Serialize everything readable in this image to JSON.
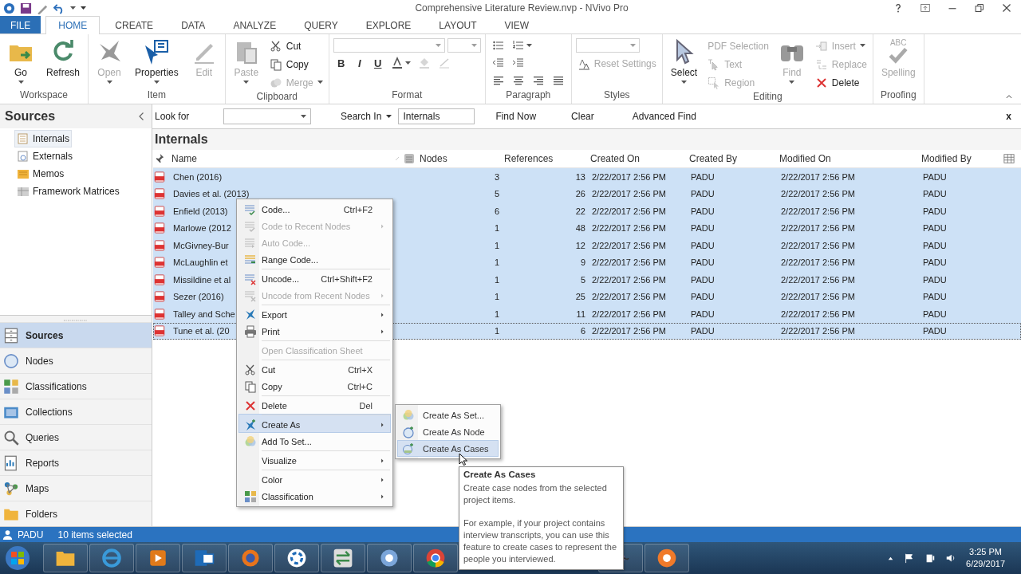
{
  "window": {
    "title": "Comprehensive Literature Review.nvp - NVivo Pro"
  },
  "ribbon_tabs": [
    {
      "label": "FILE",
      "kind": "backstage",
      "selected": false
    },
    {
      "label": "HOME",
      "kind": "tab",
      "selected": true
    },
    {
      "label": "CREATE",
      "kind": "tab",
      "selected": false
    },
    {
      "label": "DATA",
      "kind": "tab",
      "selected": false
    },
    {
      "label": "ANALYZE",
      "kind": "tab",
      "selected": false
    },
    {
      "label": "QUERY",
      "kind": "tab",
      "selected": false
    },
    {
      "label": "EXPLORE",
      "kind": "tab",
      "selected": false
    },
    {
      "label": "LAYOUT",
      "kind": "tab",
      "selected": false
    },
    {
      "label": "VIEW",
      "kind": "tab",
      "selected": false
    }
  ],
  "ribbon": {
    "groups": [
      {
        "label": "Workspace",
        "columns": [
          [
            [
              {
                "kind": "large",
                "label": "Go",
                "disabled": false,
                "dropdown": true
              }
            ]
          ],
          [
            [
              {
                "kind": "large",
                "label": "Refresh",
                "disabled": false,
                "dropdown": false
              }
            ]
          ]
        ]
      },
      {
        "label": "Item",
        "columns": [
          [
            [
              {
                "kind": "large",
                "label": "Open",
                "disabled": true,
                "dropdown": true
              }
            ]
          ],
          [
            [
              {
                "kind": "large",
                "label": "Properties",
                "disabled": false,
                "dropdown": true
              }
            ]
          ],
          [
            [
              {
                "kind": "large",
                "label": "Edit",
                "disabled": true,
                "dropdown": false
              }
            ]
          ]
        ]
      },
      {
        "label": "Clipboard",
        "columns": [
          [
            [
              {
                "kind": "large",
                "label": "Paste",
                "disabled": true,
                "dropdown": true
              }
            ]
          ],
          [
            [
              {
                "kind": "small",
                "label": "Cut",
                "disabled": false,
                "dropdown": false
              }
            ],
            [
              {
                "kind": "small",
                "label": "Copy",
                "disabled": false,
                "dropdown": false
              }
            ],
            [
              {
                "kind": "small",
                "label": "Merge",
                "disabled": true,
                "dropdown": true
              }
            ]
          ]
        ]
      },
      {
        "label": "Format",
        "columns": [
          [
            [
              {
                "kind": "font-combo",
                "disabled": true
              },
              {
                "kind": "size-combo",
                "disabled": true
              }
            ],
            [
              {
                "kind": "bold",
                "label": "B",
                "disabled": false
              },
              {
                "kind": "italic",
                "label": "I",
                "disabled": false
              },
              {
                "kind": "underline",
                "label": "U",
                "disabled": false
              },
              {
                "kind": "tool",
                "disabled": false,
                "dropdown": true
              },
              {
                "kind": "tool",
                "disabled": true,
                "dropdown": false
              },
              {
                "kind": "tool",
                "disabled": true,
                "dropdown": false
              }
            ]
          ]
        ]
      },
      {
        "label": "Paragraph",
        "columns": [
          [
            [
              {
                "kind": "tool",
                "disabled": false,
                "dropdown": false
              },
              {
                "kind": "tool",
                "disabled": false,
                "dropdown": true
              }
            ],
            [
              {
                "kind": "tool",
                "disabled": false,
                "dropdown": false
              },
              {
                "kind": "tool",
                "disabled": false,
                "dropdown": false
              }
            ],
            [
              {
                "kind": "tool",
                "disabled": false,
                "dropdown": false
              },
              {
                "kind": "tool",
                "disabled": false,
                "dropdown": false
              },
              {
                "kind": "tool",
                "disabled": false,
                "dropdown": false
              },
              {
                "kind": "tool",
                "disabled": false,
                "dropdown": false
              }
            ]
          ]
        ]
      },
      {
        "label": "Styles",
        "columns": [
          [
            [
              {
                "kind": "style-combo",
                "disabled": true
              }
            ],
            [
              {
                "kind": "small",
                "label": "Reset Settings",
                "disabled": true,
                "dropdown": false
              }
            ]
          ]
        ]
      },
      {
        "label": "Editing",
        "columns": [
          [
            [
              {
                "kind": "large",
                "label": "Select",
                "disabled": false,
                "dropdown": true
              }
            ]
          ],
          [
            [
              {
                "kind": "small",
                "label": "PDF Selection",
                "disabled": true,
                "dropdown": false
              }
            ],
            [
              {
                "kind": "small",
                "label": "Text",
                "disabled": true,
                "dropdown": false
              }
            ],
            [
              {
                "kind": "small",
                "label": "Region",
                "disabled": true,
                "dropdown": false
              }
            ]
          ],
          [
            [
              {
                "kind": "large",
                "label": "Find",
                "disabled": true,
                "dropdown": true
              }
            ]
          ],
          [
            [
              {
                "kind": "small",
                "label": "Insert",
                "disabled": true,
                "dropdown": true
              }
            ],
            [
              {
                "kind": "small",
                "label": "Replace",
                "disabled": true,
                "dropdown": false
              }
            ],
            [
              {
                "kind": "small",
                "label": "Delete",
                "disabled": false,
                "dropdown": false
              }
            ]
          ]
        ]
      },
      {
        "label": "Proofing",
        "columns": [
          [
            [
              {
                "kind": "large",
                "label": "Spelling",
                "icon_text": "ABC",
                "disabled": true,
                "dropdown": false
              }
            ]
          ]
        ]
      }
    ]
  },
  "navigation": {
    "title": "Sources",
    "tree": [
      {
        "label": "Internals",
        "selected": true
      },
      {
        "label": "Externals",
        "selected": false
      },
      {
        "label": "Memos",
        "selected": false
      },
      {
        "label": "Framework Matrices",
        "selected": false
      }
    ],
    "buttons": [
      {
        "label": "Sources",
        "selected": true
      },
      {
        "label": "Nodes",
        "selected": false
      },
      {
        "label": "Classifications",
        "selected": false
      },
      {
        "label": "Collections",
        "selected": false
      },
      {
        "label": "Queries",
        "selected": false
      },
      {
        "label": "Reports",
        "selected": false
      },
      {
        "label": "Maps",
        "selected": false
      },
      {
        "label": "Folders",
        "selected": false
      }
    ]
  },
  "find_bar": {
    "look_for_label": "Look for",
    "search_in_label": "Search In",
    "search_in_value": "Internals",
    "buttons": [
      "Find Now",
      "Clear",
      "Advanced Find"
    ],
    "close": "x"
  },
  "list_view": {
    "title": "Internals",
    "columns": [
      "Name",
      "Nodes",
      "References",
      "Created On",
      "Created By",
      "Modified On",
      "Modified By"
    ],
    "rows": [
      {
        "name": "Chen (2016)",
        "nodes": "3",
        "references": "13",
        "created_on": "2/22/2017 2:56 PM",
        "created_by": "PADU",
        "modified_on": "2/22/2017 2:56 PM",
        "modified_by": "PADU",
        "selected": true,
        "focused": false
      },
      {
        "name": "Davies et al. (2013)",
        "nodes": "5",
        "references": "26",
        "created_on": "2/22/2017 2:56 PM",
        "created_by": "PADU",
        "modified_on": "2/22/2017 2:56 PM",
        "modified_by": "PADU",
        "selected": true,
        "focused": false
      },
      {
        "name": "Enfield (2013)",
        "nodes": "6",
        "references": "22",
        "created_on": "2/22/2017 2:56 PM",
        "created_by": "PADU",
        "modified_on": "2/22/2017 2:56 PM",
        "modified_by": "PADU",
        "selected": true,
        "focused": false
      },
      {
        "name": "Marlowe (2012",
        "nodes": "1",
        "references": "48",
        "created_on": "2/22/2017 2:56 PM",
        "created_by": "PADU",
        "modified_on": "2/22/2017 2:56 PM",
        "modified_by": "PADU",
        "selected": true,
        "focused": false
      },
      {
        "name": "McGivney-Bur",
        "nodes": "1",
        "references": "12",
        "created_on": "2/22/2017 2:56 PM",
        "created_by": "PADU",
        "modified_on": "2/22/2017 2:56 PM",
        "modified_by": "PADU",
        "selected": true,
        "focused": false
      },
      {
        "name": "McLaughlin et",
        "nodes": "1",
        "references": "9",
        "created_on": "2/22/2017 2:56 PM",
        "created_by": "PADU",
        "modified_on": "2/22/2017 2:56 PM",
        "modified_by": "PADU",
        "selected": true,
        "focused": false
      },
      {
        "name": "Missildine et al",
        "nodes": "1",
        "references": "5",
        "created_on": "2/22/2017 2:56 PM",
        "created_by": "PADU",
        "modified_on": "2/22/2017 2:56 PM",
        "modified_by": "PADU",
        "selected": true,
        "focused": false
      },
      {
        "name": "Sezer (2016)",
        "nodes": "1",
        "references": "25",
        "created_on": "2/22/2017 2:56 PM",
        "created_by": "PADU",
        "modified_on": "2/22/2017 2:56 PM",
        "modified_by": "PADU",
        "selected": true,
        "focused": false
      },
      {
        "name": "Talley and Sche",
        "nodes": "1",
        "references": "11",
        "created_on": "2/22/2017 2:56 PM",
        "created_by": "PADU",
        "modified_on": "2/22/2017 2:56 PM",
        "modified_by": "PADU",
        "selected": true,
        "focused": false
      },
      {
        "name": "Tune et al. (20",
        "nodes": "1",
        "references": "6",
        "created_on": "2/22/2017 2:56 PM",
        "created_by": "PADU",
        "modified_on": "2/22/2017 2:56 PM",
        "modified_by": "PADU",
        "selected": true,
        "focused": true
      }
    ]
  },
  "context_menu": {
    "items": [
      {
        "label": "Code...",
        "shortcut": "Ctrl+F2",
        "disabled": false,
        "submenu": false,
        "selected": false,
        "separator_before": false
      },
      {
        "label": "Code to Recent Nodes",
        "disabled": true,
        "submenu": true,
        "selected": false,
        "separator_before": false
      },
      {
        "label": "Auto Code...",
        "disabled": true,
        "submenu": false,
        "selected": false,
        "separator_before": false
      },
      {
        "label": "Range Code...",
        "disabled": false,
        "submenu": false,
        "selected": false,
        "separator_before": false
      },
      {
        "label": "Uncode...",
        "shortcut": "Ctrl+Shift+F2",
        "disabled": false,
        "submenu": false,
        "selected": false,
        "separator_before": true
      },
      {
        "label": "Uncode from Recent Nodes",
        "disabled": true,
        "submenu": true,
        "selected": false,
        "separator_before": false
      },
      {
        "label": "Export",
        "disabled": false,
        "submenu": true,
        "selected": false,
        "separator_before": true
      },
      {
        "label": "Print",
        "disabled": false,
        "submenu": true,
        "selected": false,
        "separator_before": false
      },
      {
        "label": "Open Classification Sheet",
        "disabled": true,
        "submenu": false,
        "selected": false,
        "separator_before": true
      },
      {
        "label": "Cut",
        "shortcut": "Ctrl+X",
        "disabled": false,
        "submenu": false,
        "selected": false,
        "separator_before": true
      },
      {
        "label": "Copy",
        "shortcut": "Ctrl+C",
        "disabled": false,
        "submenu": false,
        "selected": false,
        "separator_before": false
      },
      {
        "label": "Delete",
        "shortcut": "Del",
        "disabled": false,
        "submenu": false,
        "selected": false,
        "separator_before": true
      },
      {
        "label": "Create As",
        "disabled": false,
        "submenu": true,
        "selected": true,
        "separator_before": true
      },
      {
        "label": "Add To Set...",
        "disabled": false,
        "submenu": false,
        "selected": false,
        "separator_before": false
      },
      {
        "label": "Visualize",
        "disabled": false,
        "submenu": true,
        "selected": false,
        "separator_before": true
      },
      {
        "label": "Color",
        "disabled": false,
        "submenu": true,
        "selected": false,
        "separator_before": true
      },
      {
        "label": "Classification",
        "disabled": false,
        "submenu": true,
        "selected": false,
        "separator_before": false
      }
    ]
  },
  "submenu": {
    "items": [
      {
        "label": "Create As Set...",
        "selected": false
      },
      {
        "label": "Create As Node",
        "selected": false
      },
      {
        "label": "Create As Cases",
        "selected": true
      }
    ]
  },
  "tooltip": {
    "title": "Create As Cases",
    "paragraphs": [
      "Create case nodes from the selected project items.",
      "For example, if your project contains interview transcripts, you can use this feature to create cases to represent the people you interviewed."
    ]
  },
  "status_bar": {
    "user": "PADU",
    "selection": "10 items selected"
  },
  "taskbar": {
    "time": "3:25 PM",
    "date": "6/29/2017"
  }
}
